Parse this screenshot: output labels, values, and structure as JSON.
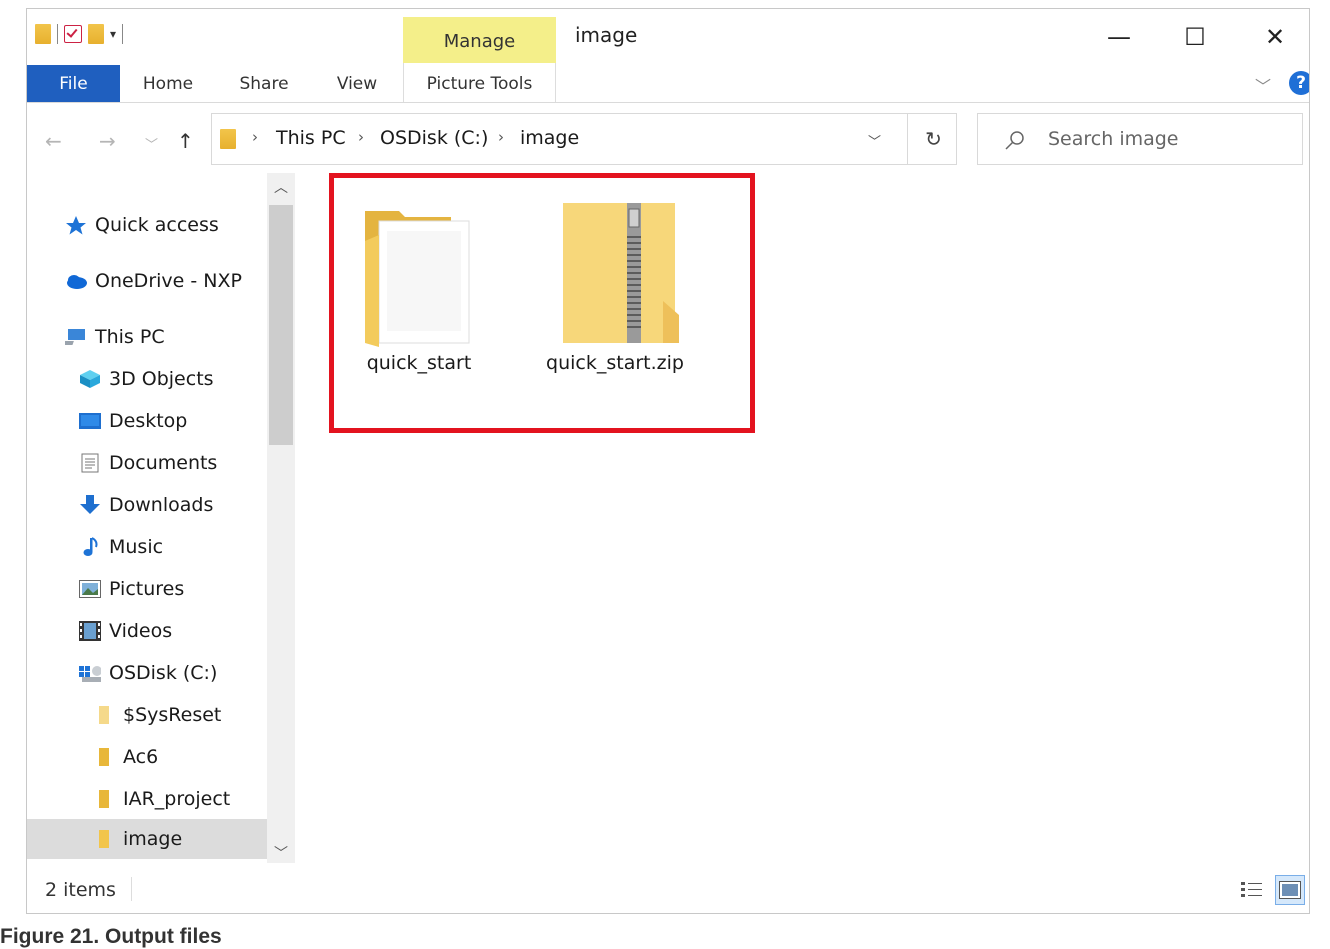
{
  "window": {
    "title": "image",
    "contextual_tab_group": "Manage",
    "controls": {
      "minimize": "—",
      "maximize": "☐",
      "close": "✕"
    }
  },
  "ribbon": {
    "tabs": [
      "File",
      "Home",
      "Share",
      "View",
      "Picture Tools"
    ],
    "help": "?"
  },
  "address_bar": {
    "breadcrumb": [
      "This PC",
      "OSDisk (C:)",
      "image"
    ],
    "search_placeholder": "Search image"
  },
  "nav_pane": {
    "items": [
      {
        "label": "Quick access",
        "icon": "star-icon"
      },
      {
        "label": "OneDrive - NXP",
        "icon": "cloud-icon"
      },
      {
        "label": "This PC",
        "icon": "computer-icon"
      },
      {
        "label": "3D Objects",
        "icon": "cube-icon"
      },
      {
        "label": "Desktop",
        "icon": "desktop-icon"
      },
      {
        "label": "Documents",
        "icon": "document-icon"
      },
      {
        "label": "Downloads",
        "icon": "download-icon"
      },
      {
        "label": "Music",
        "icon": "music-icon"
      },
      {
        "label": "Pictures",
        "icon": "picture-icon"
      },
      {
        "label": "Videos",
        "icon": "video-icon"
      },
      {
        "label": "OSDisk (C:)",
        "icon": "drive-icon"
      },
      {
        "label": "$SysReset",
        "icon": "folder-icon"
      },
      {
        "label": "Ac6",
        "icon": "folder-icon"
      },
      {
        "label": "IAR_project",
        "icon": "folder-icon"
      },
      {
        "label": "image",
        "icon": "folder-icon",
        "selected": true
      }
    ]
  },
  "files": [
    {
      "name": "quick_start",
      "icon": "folder-icon"
    },
    {
      "name": "quick_start.zip",
      "icon": "zip-folder-icon"
    }
  ],
  "status_bar": {
    "item_count": "2 items"
  },
  "figure_caption": "Figure 21.  Output files",
  "colors": {
    "file_tab": "#1f5fbf",
    "manage_tab": "#f4ef8a",
    "highlight": "#e3131f",
    "folder": "#f2c54b"
  }
}
